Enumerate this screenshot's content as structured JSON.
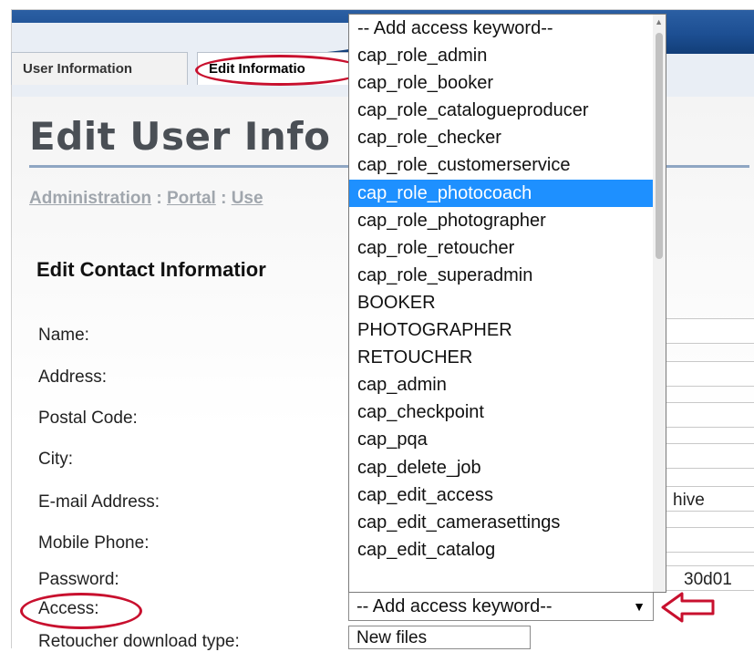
{
  "tabs": [
    {
      "label": "User Information"
    },
    {
      "label": "Edit Informatio"
    }
  ],
  "page": {
    "title": "Edit User Info",
    "breadcrumb": [
      "Administration",
      "Portal",
      "Use"
    ],
    "breadcrumb_separator": ":",
    "section_title": "Edit Contact Informatior"
  },
  "form": {
    "labels": [
      "Name:",
      "Address:",
      "Postal Code:",
      "City:",
      "E-mail Address:",
      "Mobile Phone:",
      "Password:",
      "Access:",
      "Retoucher download type:"
    ],
    "email_value_fragment": "hive",
    "password_value_fragment": "30d01",
    "access_select_value": "-- Add access keyword--",
    "download_type_value": "New files"
  },
  "dropdown": {
    "options": [
      "-- Add access keyword--",
      "cap_role_admin",
      "cap_role_booker",
      "cap_role_catalogueproducer",
      "cap_role_checker",
      "cap_role_customerservice",
      "cap_role_photocoach",
      "cap_role_photographer",
      "cap_role_retoucher",
      "cap_role_superadmin",
      "BOOKER",
      "PHOTOGRAPHER",
      "RETOUCHER",
      "cap_admin",
      "cap_checkpoint",
      "cap_pqa",
      "cap_delete_job",
      "cap_edit_access",
      "cap_edit_camerasettings",
      "cap_edit_catalog"
    ],
    "highlighted_option": "cap_role_photocoach"
  },
  "icons": {
    "select_arrow": "chevron-down-icon",
    "scroll_up": "scroll-up-arrow-icon",
    "annotation_arrow": "left-arrow-annotation-icon"
  },
  "colors": {
    "header": "#1d4f93",
    "selection": "#1e90ff",
    "annotation": "#c8102e"
  }
}
